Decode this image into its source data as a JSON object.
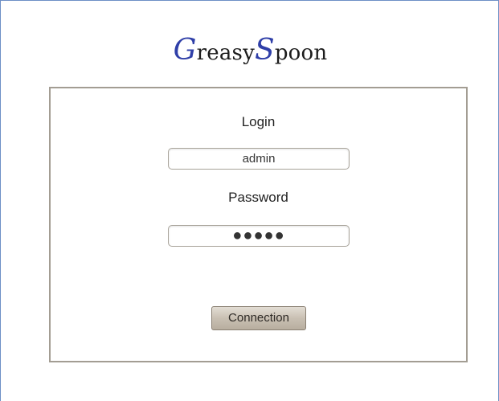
{
  "logo": {
    "first_cap": "G",
    "first_rest": "reasy",
    "second_cap": "S",
    "second_rest": "poon",
    "accent_color": "#2f3fa8"
  },
  "login_form": {
    "login_label": "Login",
    "login_value": "admin",
    "password_label": "Password",
    "password_value": "●●●●●",
    "submit_label": "Connection"
  }
}
